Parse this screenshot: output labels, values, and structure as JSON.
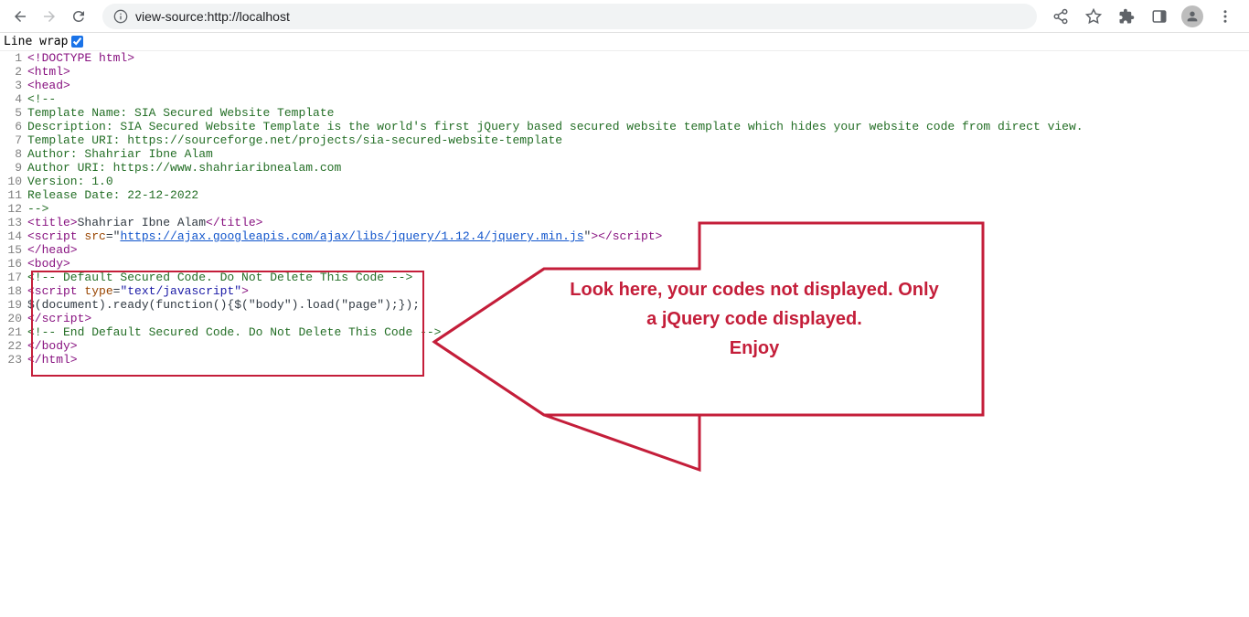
{
  "toolbar": {
    "url": "view-source:http://localhost"
  },
  "linewrap": {
    "label": "Line wrap",
    "checked": true
  },
  "source_lines": [
    {
      "n": "1",
      "html": "<span class='tag'>&lt;!DOCTYPE html&gt;</span>"
    },
    {
      "n": "2",
      "html": "<span class='tag'>&lt;html&gt;</span>"
    },
    {
      "n": "3",
      "html": "<span class='tag'>&lt;head&gt;</span>"
    },
    {
      "n": "4",
      "html": "<span class='comment'>&lt;!--</span>"
    },
    {
      "n": "5",
      "html": "<span class='comment'>Template Name: SIA Secured Website Template</span>"
    },
    {
      "n": "6",
      "html": "<span class='comment'>Description: SIA Secured Website Template is the world's first jQuery based secured website template which hides your website code from direct view.</span>"
    },
    {
      "n": "7",
      "html": "<span class='comment'>Template URI: https://sourceforge.net/projects/sia-secured-website-template</span>"
    },
    {
      "n": "8",
      "html": "<span class='comment'>Author: Shahriar Ibne Alam</span>"
    },
    {
      "n": "9",
      "html": "<span class='comment'>Author URI: https://www.shahriaribnealam.com</span>"
    },
    {
      "n": "10",
      "html": "<span class='comment'>Version: 1.0</span>"
    },
    {
      "n": "11",
      "html": "<span class='comment'>Release Date: 22-12-2022</span>"
    },
    {
      "n": "12",
      "html": "<span class='comment'>--&gt;</span>"
    },
    {
      "n": "13",
      "html": "<span class='tag'>&lt;title&gt;</span>Shahriar Ibne Alam<span class='tag'>&lt;/title&gt;</span>"
    },
    {
      "n": "14",
      "html": "<span class='tag'>&lt;script</span> <span class='attr'>src</span>=\"<span class='link'>https://ajax.googleapis.com/ajax/libs/jquery/1.12.4/jquery.min.js</span>\"<span class='tag'>&gt;&lt;/script&gt;</span>"
    },
    {
      "n": "15",
      "html": "<span class='tag'>&lt;/head&gt;</span>"
    },
    {
      "n": "16",
      "html": "<span class='tag'>&lt;body&gt;</span>"
    },
    {
      "n": "17",
      "html": "<span class='comment'>&lt;!-- Default Secured Code. Do Not Delete This Code --&gt;</span>"
    },
    {
      "n": "18",
      "html": "<span class='tag'>&lt;script</span> <span class='attr'>type</span>=<span class='str'>\"text/javascript\"</span><span class='tag'>&gt;</span>"
    },
    {
      "n": "19",
      "html": "$(document).ready(function(){$(\"body\").load(\"page\");});"
    },
    {
      "n": "20",
      "html": "<span class='tag'>&lt;/script&gt;</span>"
    },
    {
      "n": "21",
      "html": "<span class='comment'>&lt;!-- End Default Secured Code. Do Not Delete This Code --&gt;</span>"
    },
    {
      "n": "22",
      "html": "<span class='tag'>&lt;/body&gt;</span>"
    },
    {
      "n": "23",
      "html": "<span class='tag'>&lt;/html&gt;</span>"
    }
  ],
  "annotation": {
    "line1": "Look here, your codes not displayed. Only",
    "line2": "a jQuery code displayed.",
    "line3": "Enjoy"
  }
}
